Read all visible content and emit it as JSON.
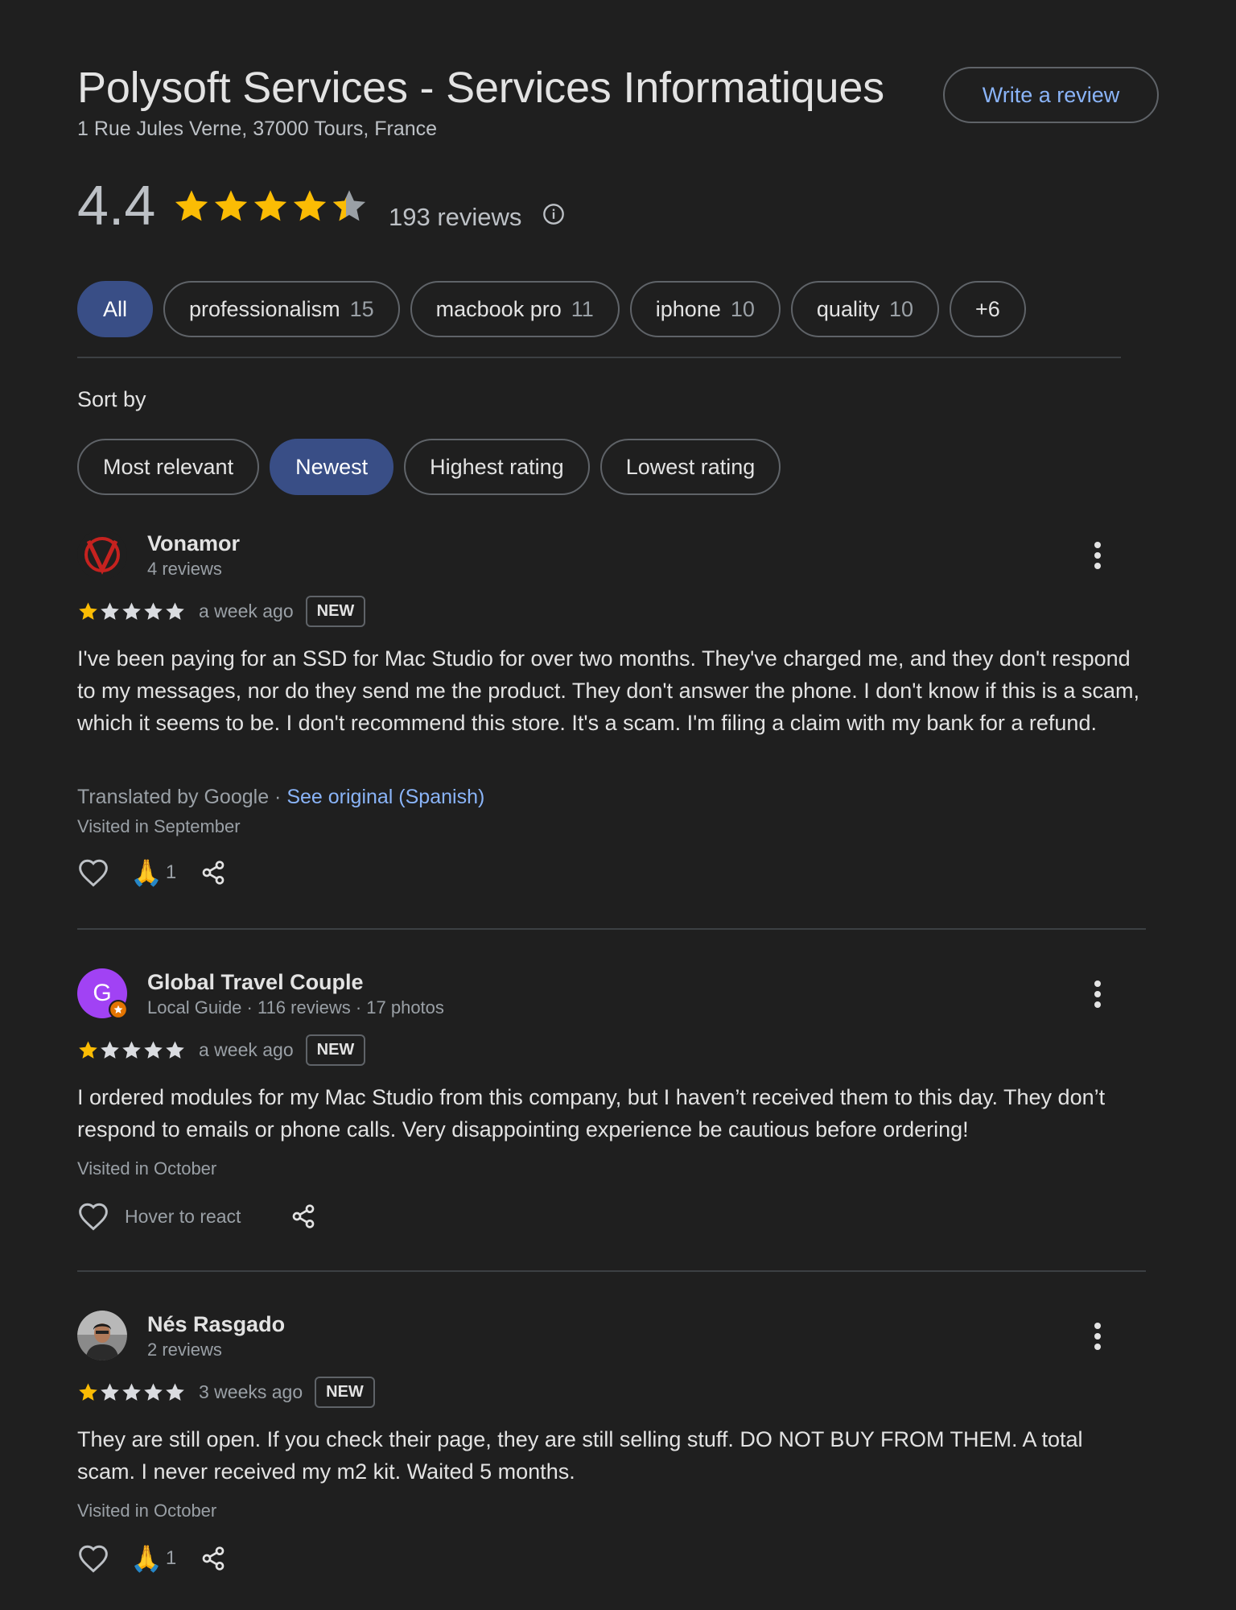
{
  "place": {
    "title": "Polysoft Services - Services Informatiques",
    "address": "1 Rue Jules Verne, 37000 Tours, France",
    "write_review_label": "Write a review",
    "rating": "4.4",
    "rating_value": 4.4,
    "reviews_count": "193 reviews"
  },
  "topics": [
    {
      "label": "All",
      "count": ""
    },
    {
      "label": "professionalism",
      "count": "15"
    },
    {
      "label": "macbook pro",
      "count": "11"
    },
    {
      "label": "iphone",
      "count": "10"
    },
    {
      "label": "quality",
      "count": "10"
    },
    {
      "label": "+6",
      "count": ""
    }
  ],
  "sort": {
    "label": "Sort by",
    "options": [
      "Most relevant",
      "Newest",
      "Highest rating",
      "Lowest rating"
    ],
    "selected": "Newest"
  },
  "reviews": [
    {
      "name": "Vonamor",
      "sub": "4 reviews",
      "rating": 1,
      "time": "a week ago",
      "badge": "NEW",
      "text": "I've been paying for an SSD for Mac Studio for over two months. They've charged me, and they don't respond to my messages, nor do they send me the product. They don't answer the phone. I don't know if this is a scam, which it seems to be. I don't recommend this store. It's a scam. I'm filing a claim with my bank for a refund.",
      "translated": "Translated by Google",
      "translated_sep": " · ",
      "see_original": "See original (Spanish)",
      "visited": "Visited in September",
      "reaction_emoji": "🙏",
      "reaction_count": "1"
    },
    {
      "name": "Global Travel Couple",
      "sub": "Local Guide · 116 reviews · 17 photos",
      "avatar_letter": "G",
      "avatar_color": "#a142f4",
      "rating": 1,
      "time": "a week ago",
      "badge": "NEW",
      "text": "I ordered modules for my Mac Studio from this company, but I haven’t received them to this day. They don’t respond to emails or phone calls. Very disappointing experience be cautious before ordering!",
      "visited": "Visited in October",
      "hover_text": "Hover to react"
    },
    {
      "name": "Nés Rasgado",
      "sub": "2 reviews",
      "rating": 1,
      "time": "3 weeks ago",
      "badge": "NEW",
      "text": "They are still open. If you check their page, they are still selling stuff. DO NOT BUY FROM THEM. A total scam. I never received my m2 kit. Waited 5 months.",
      "visited": "Visited in October",
      "reaction_emoji": "🙏",
      "reaction_count": "1"
    }
  ],
  "colors": {
    "background": "#1f1f1f",
    "star_gold": "#fbbc04",
    "star_empty": "#dadce0",
    "link": "#8ab4f8",
    "chip_active": "#394e86"
  },
  "icons": [
    "info-icon",
    "more-vert-icon",
    "heart-icon",
    "share-icon",
    "star-icon"
  ]
}
